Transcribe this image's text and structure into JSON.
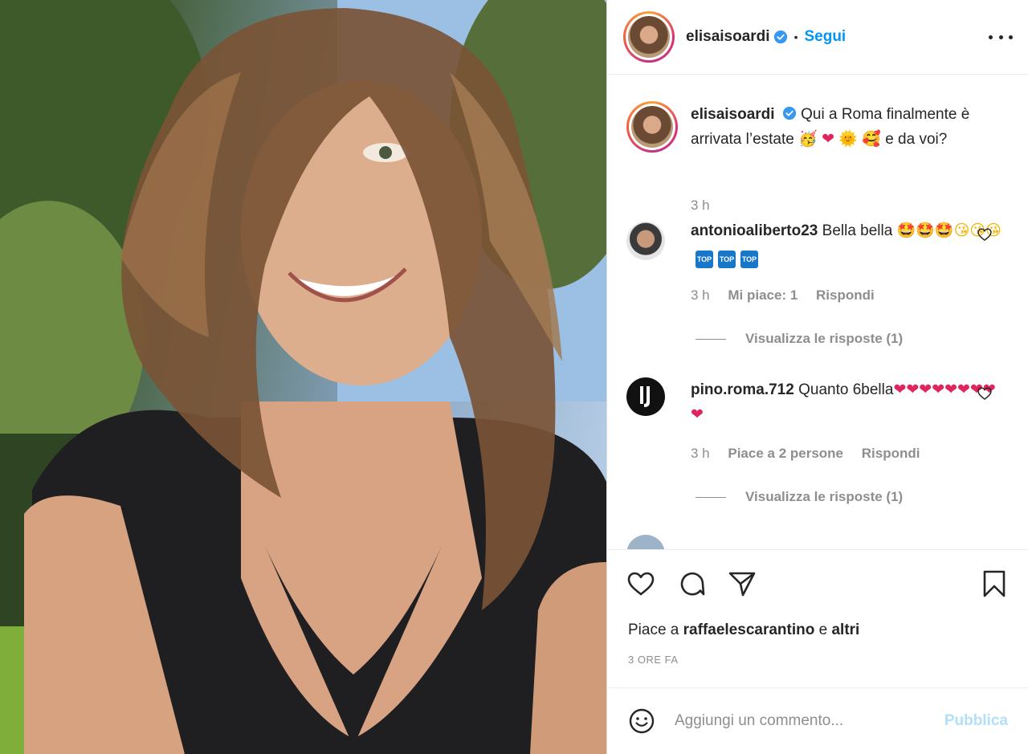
{
  "post": {
    "username": "elisaisoardi",
    "follow_label": "Segui",
    "separator": "•",
    "caption_text": "Qui a Roma finalmente è arrivata l’estate",
    "caption_emojis": [
      "🥳",
      "❤",
      "🌞",
      "🥰"
    ],
    "caption_tail": "e da voi?",
    "caption_time": "3 h"
  },
  "comments": [
    {
      "username": "antonioaliberto23",
      "text": "Bella bella",
      "emojis": "🤩🤩🤩😘😘😘",
      "badges": [
        "TOP",
        "TOP",
        "TOP"
      ],
      "time": "3 h",
      "likes": "Mi piace: 1",
      "reply": "Rispondi",
      "view_replies": "Visualizza le risposte (1)"
    },
    {
      "username": "pino.roma.712",
      "text": "Quanto 6bella",
      "emojis": "❤❤❤❤❤❤❤❤❤",
      "time": "3 h",
      "likes": "Piace a 2 persone",
      "reply": "Rispondi",
      "view_replies": "Visualizza le risposte (1)"
    }
  ],
  "likes": {
    "prefix": "Piace a",
    "user": "raffaelescarantino",
    "middle": "e",
    "suffix": "altri"
  },
  "timestamp": "3 ORE FA",
  "add_comment": {
    "placeholder": "Aggiungi un commento...",
    "publish_label": "Pubblica"
  },
  "colors": {
    "accent": "#0095f6",
    "publish_disabled": "#b2dffc",
    "secondary_text": "#8e8e8e"
  },
  "icons": [
    "verified-badge-icon",
    "more-options-icon",
    "heart-icon",
    "comment-icon",
    "share-icon",
    "bookmark-icon",
    "emoji-icon"
  ]
}
